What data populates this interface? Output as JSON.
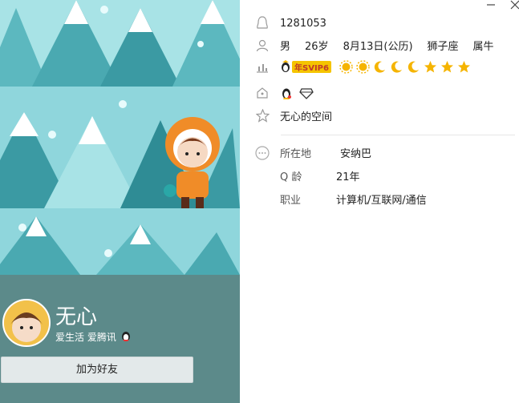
{
  "window": {
    "minimize_icon": "minimize-icon",
    "close_icon": "close-icon"
  },
  "profile": {
    "nickname": "无心",
    "signature": "爱生活 爱腾讯",
    "add_friend_label": "加为好友",
    "qq_number": "1281053",
    "gender": "男",
    "age": "26岁",
    "birthday": "8月13日(公历)",
    "constellation": "狮子座",
    "zodiac": "属牛",
    "vip_label": "年SVIP6",
    "space_label": "无心的空间"
  },
  "details": [
    {
      "label": "所在地",
      "value": "安纳巴"
    },
    {
      "label": "Q 龄",
      "value": "21年"
    },
    {
      "label": "职业",
      "value": "计算机/互联网/通信"
    }
  ],
  "level_icons": [
    "sun-icon",
    "sun-icon",
    "moon-icon",
    "moon-icon",
    "moon-icon",
    "star-icon",
    "star-icon",
    "star-icon"
  ],
  "colors": {
    "bottom_panel": "#5c8a8a",
    "sky": "#8fd6dc",
    "accent_orange": "#f08c28",
    "gold": "#f5b400"
  }
}
